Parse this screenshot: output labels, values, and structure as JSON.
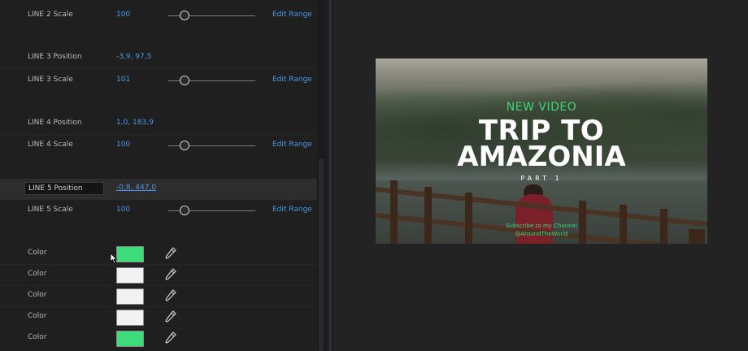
{
  "properties": {
    "rows": [
      {
        "label": "LINE 2 Scale",
        "value": "100",
        "has_slider": true,
        "edit_range": "Edit Range"
      },
      {
        "label": "LINE 3 Position",
        "value": "-3,9, 97,5"
      },
      {
        "label": "LINE 3 Scale",
        "value": "101",
        "has_slider": true,
        "edit_range": "Edit Range"
      },
      {
        "label": "LINE 4 Position",
        "value": "1,0, 183,9"
      },
      {
        "label": "LINE 4 Scale",
        "value": "100",
        "has_slider": true,
        "edit_range": "Edit Range"
      },
      {
        "label": "LINE 5 Position",
        "value": "-0,8, 447,0",
        "selected": true
      },
      {
        "label": "LINE 5 Scale",
        "value": "100",
        "has_slider": true,
        "edit_range": "Edit Range"
      }
    ],
    "colors": [
      {
        "label": "Color",
        "swatch": "#3ddc7a",
        "icon": "eyedropper-icon"
      },
      {
        "label": "Color",
        "swatch": "#f2f2f2",
        "icon": "eyedropper-icon"
      },
      {
        "label": "Color",
        "swatch": "#f2f2f2",
        "icon": "eyedropper-icon"
      },
      {
        "label": "Color",
        "swatch": "#f2f2f2",
        "icon": "eyedropper-icon"
      },
      {
        "label": "Color",
        "swatch": "#3ddc7a",
        "icon": "eyedropper-icon"
      }
    ]
  },
  "preview": {
    "new_video": "NEW VIDEO",
    "title_line1": "TRIP TO",
    "title_line2": "AMAZONIA",
    "part": "PART 1",
    "subscribe": "Subscribe to my Channel",
    "handle": "@AroundTheWorld"
  },
  "colors": {
    "accent_blue": "#4a98e6",
    "accent_green": "#3ed67a"
  }
}
